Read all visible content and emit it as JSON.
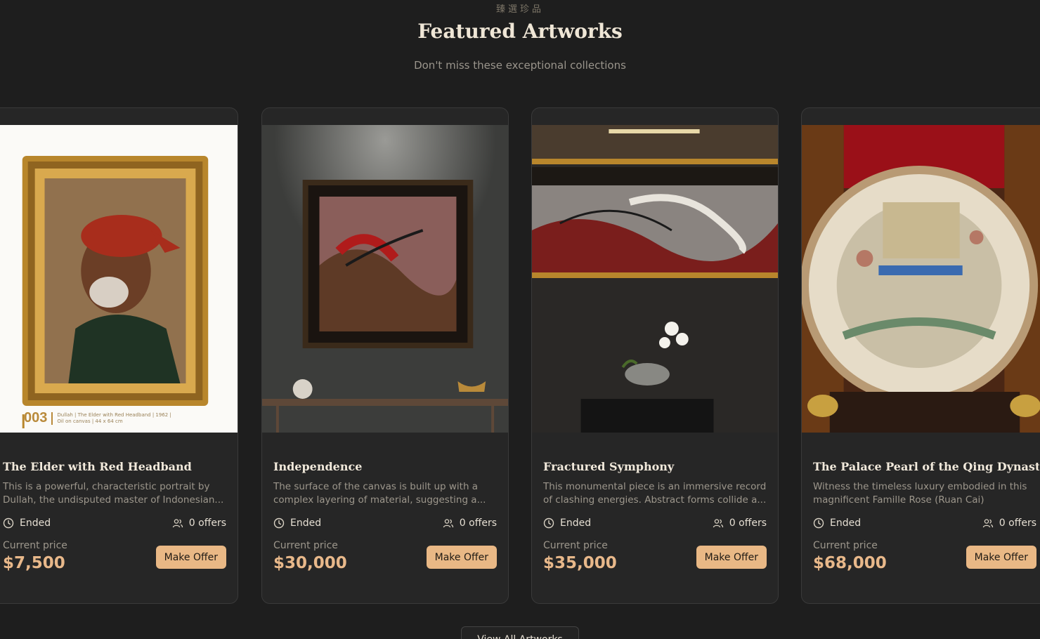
{
  "header": {
    "eyebrow": "臻選珍品",
    "title": "Featured Artworks",
    "subtitle": "Don't miss these exceptional collections"
  },
  "labels": {
    "current_price": "Current price",
    "make_offer": "Make Offer",
    "view_all": "View All Artworks"
  },
  "colors": {
    "background": "#1e1e1e",
    "card": "#262626",
    "accent": "#e9b885",
    "price": "#e8b88a"
  },
  "cards": [
    {
      "title": "The Elder with Red Headband",
      "description": "This is a powerful, characteristic portrait by Dullah, the undisputed master of Indonesian...",
      "status": "Ended",
      "offers": "0 offers",
      "price": "$7,500",
      "image_caption_number": "003",
      "image_caption_line1": "Dullah | The Elder with Red Headband | 1962 |",
      "image_caption_line2": "Oil on canvas | 44 x 64 cm"
    },
    {
      "title": "Independence",
      "description": "The surface of the canvas is built up with a complex layering of material, suggesting a...",
      "status": "Ended",
      "offers": "0 offers",
      "price": "$30,000"
    },
    {
      "title": "Fractured Symphony",
      "description": "This monumental piece is an immersive record of clashing energies. Abstract forms collide a...",
      "status": "Ended",
      "offers": "0 offers",
      "price": "$35,000"
    },
    {
      "title": "The Palace Pearl of the Qing Dynasty",
      "description": "Witness the timeless luxury embodied in this magnificent Famille Rose (Ruan Cai) Porcelain...",
      "status": "Ended",
      "offers": "0 offers",
      "price": "$68,000"
    }
  ]
}
